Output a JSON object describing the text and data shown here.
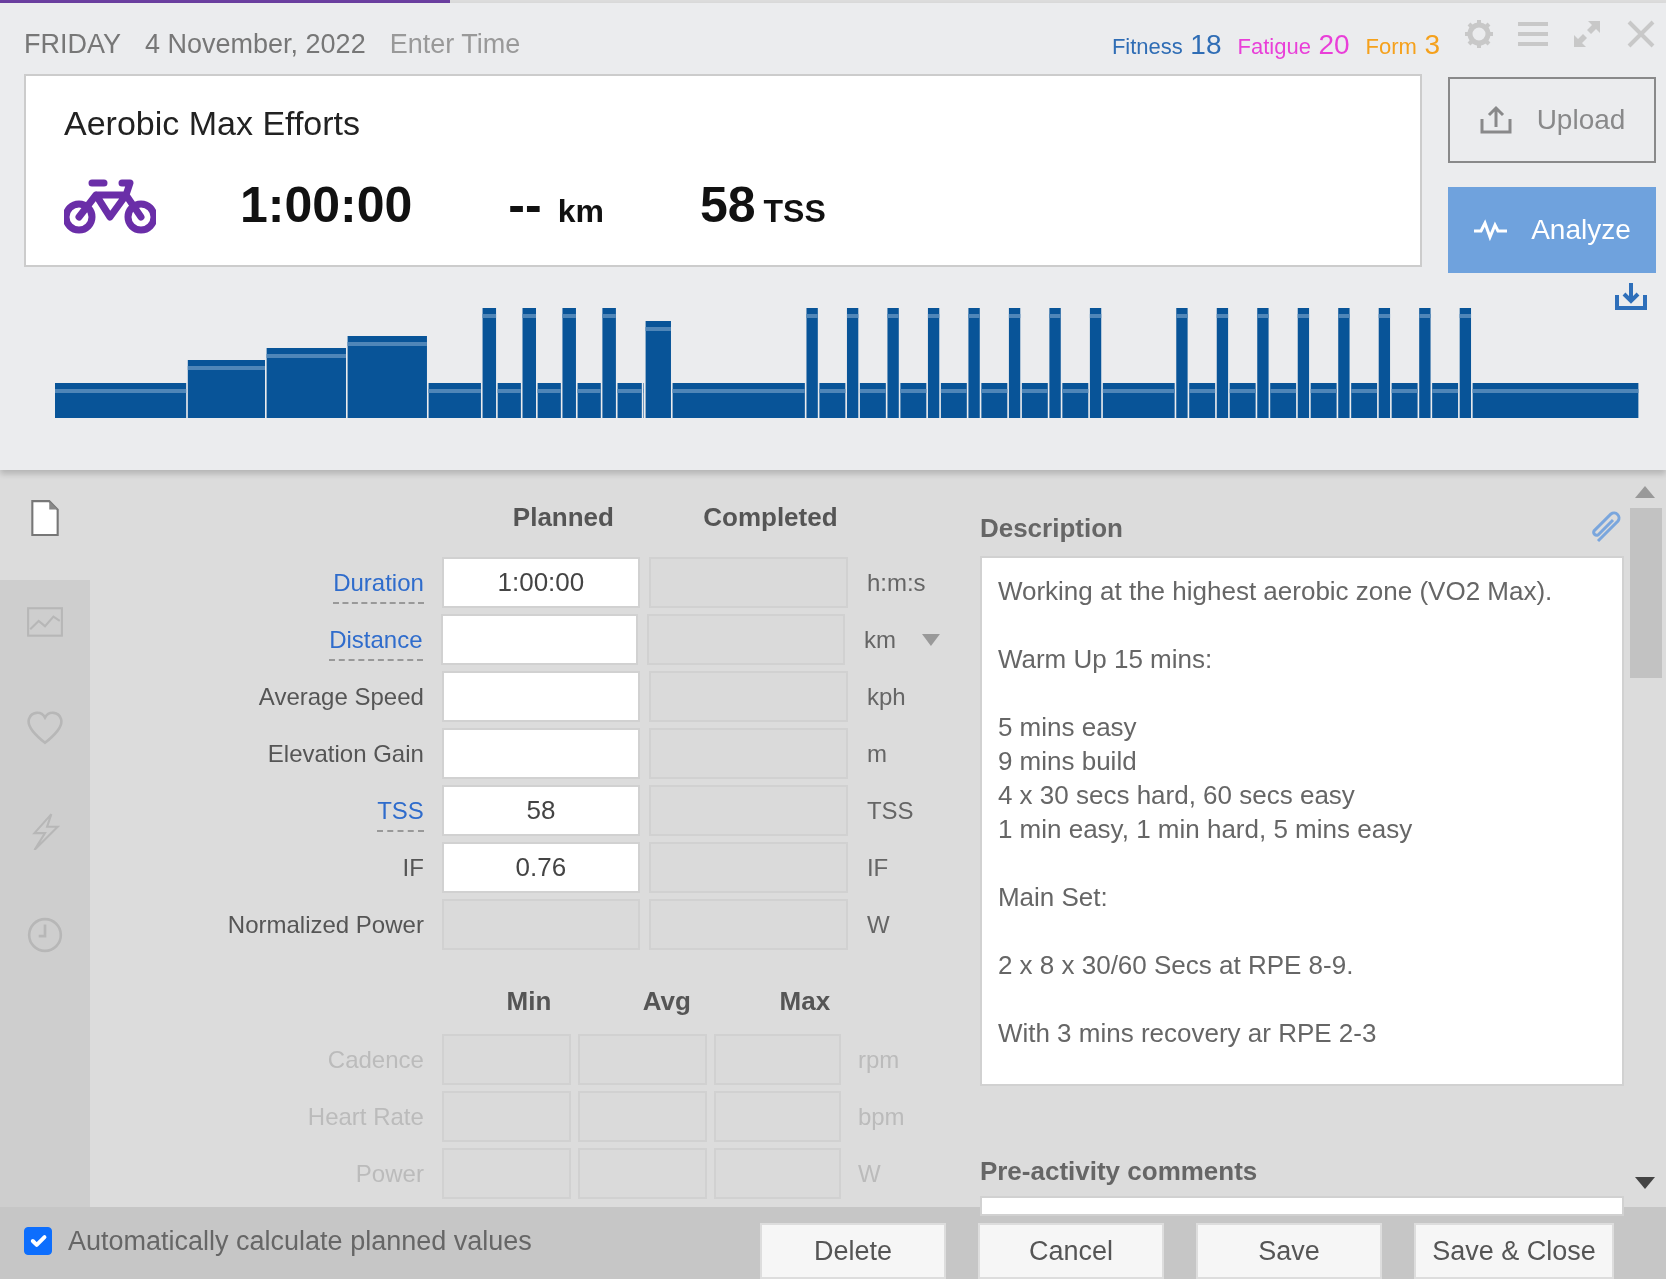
{
  "header": {
    "day": "FRIDAY",
    "date": "4 November, 2022",
    "time_link": "Enter Time",
    "metrics": [
      {
        "label": "Fitness",
        "value": "18",
        "color": "#2f6db5"
      },
      {
        "label": "Fatigue",
        "value": "20",
        "color": "#e93fd8"
      },
      {
        "label": "Form",
        "value": "3",
        "color": "#f5a11c"
      }
    ]
  },
  "summary": {
    "title": "Aerobic Max Efforts",
    "duration": "1:00:00",
    "distance_value": "--",
    "distance_unit": "km",
    "tss_value": "58",
    "tss_unit": "TSS"
  },
  "actions": [
    {
      "label": "Upload",
      "disabled": true
    },
    {
      "label": "Analyze",
      "disabled": false
    }
  ],
  "sidebar": [
    {
      "selected": true
    },
    {
      "selected": false
    },
    {
      "selected": false
    },
    {
      "selected": false
    },
    {
      "selected": false
    }
  ],
  "form": {
    "columns": [
      "Planned",
      "Completed"
    ],
    "rows": [
      {
        "label": "Duration",
        "linked": true,
        "planned": "1:00:00",
        "editable": true,
        "unit": "h:m:s",
        "dropdown": false
      },
      {
        "label": "Distance",
        "linked": true,
        "editable": true,
        "unit": "km",
        "dropdown": true
      },
      {
        "label": "Average Speed",
        "linked": false,
        "editable": true,
        "unit": "kph",
        "dropdown": false
      },
      {
        "label": "Elevation Gain",
        "linked": false,
        "editable": true,
        "unit": "m",
        "dropdown": false
      },
      {
        "label": "TSS",
        "linked": true,
        "planned": "58",
        "editable": true,
        "unit": "TSS",
        "dropdown": false
      },
      {
        "label": "IF",
        "linked": false,
        "planned": "0.76",
        "editable": true,
        "unit": "IF",
        "dropdown": false
      },
      {
        "label": "Normalized Power",
        "linked": false,
        "editable": false,
        "unit": "W",
        "dropdown": false
      }
    ]
  },
  "ranges": {
    "columns": [
      "Min",
      "Avg",
      "Max"
    ],
    "rows": [
      {
        "label": "Cadence",
        "unit": "rpm",
        "disabled": true
      },
      {
        "label": "Heart Rate",
        "unit": "bpm",
        "disabled": true
      },
      {
        "label": "Power",
        "unit": "W",
        "disabled": true
      }
    ]
  },
  "description": {
    "heading": "Description",
    "text": "Working at the highest aerobic zone (VO2 Max).\n\nWarm Up 15 mins:\n\n5 mins easy\n9 mins build\n4 x 30 secs hard, 60 secs easy\n1 min easy, 1 min hard, 5 mins easy\n\nMain Set:\n\n2 x 8 x 30/60 Secs at RPE 8-9.\n\nWith 3 mins recovery ar RPE 2-3"
  },
  "comments": {
    "heading": "Pre-activity comments"
  },
  "footer": {
    "auto_calculate": {
      "label": "Automatically calculate planned values",
      "checked": true
    },
    "buttons": [
      "Delete",
      "Cancel",
      "Save",
      "Save & Close"
    ]
  }
}
